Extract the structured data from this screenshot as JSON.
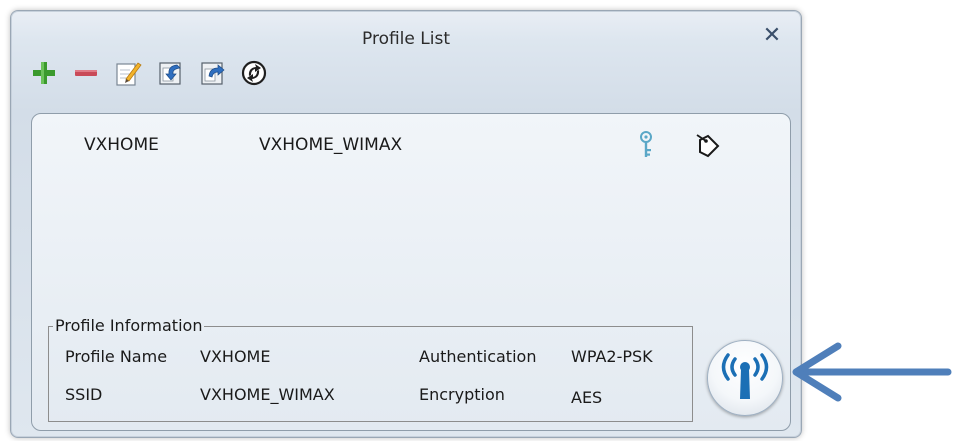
{
  "window": {
    "title": "Profile List",
    "close_symbol": "✕"
  },
  "toolbar": {
    "buttons": [
      {
        "name": "add-profile-button",
        "icon": "plus-icon",
        "color": "#3b9a2d"
      },
      {
        "name": "remove-profile-button",
        "icon": "minus-icon",
        "color": "#c94a58"
      },
      {
        "name": "edit-profile-button",
        "icon": "edit-icon"
      },
      {
        "name": "import-profile-button",
        "icon": "import-icon"
      },
      {
        "name": "export-profile-button",
        "icon": "export-icon"
      },
      {
        "name": "refresh-button",
        "icon": "refresh-icon"
      }
    ]
  },
  "profiles": [
    {
      "name": "VXHOME",
      "ssid": "VXHOME_WIMAX",
      "icons": [
        "key-icon",
        "tag-icon"
      ]
    }
  ],
  "info": {
    "legend": "Profile Information",
    "profile_name_label": "Profile Name",
    "profile_name_value": "VXHOME",
    "ssid_label": "SSID",
    "ssid_value": "VXHOME_WIMAX",
    "auth_label": "Authentication",
    "auth_value": "WPA2-PSK",
    "enc_label": "Encryption",
    "enc_value": "AES"
  },
  "connect": {
    "icon": "wireless-signal-icon",
    "accent": "#1b6fb5"
  },
  "annotation": {
    "icon": "pointer-arrow-icon",
    "color": "#4f7fba"
  }
}
